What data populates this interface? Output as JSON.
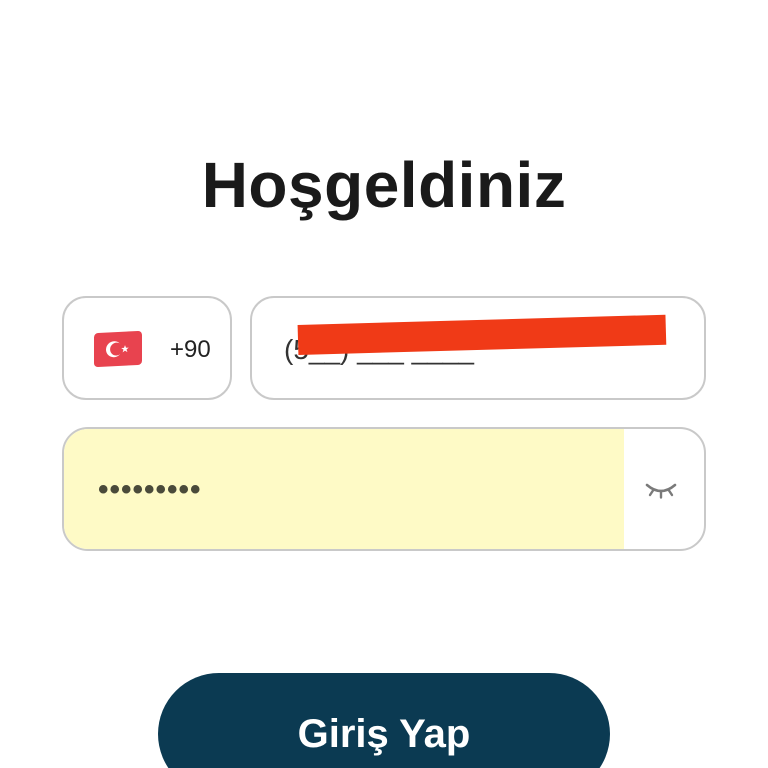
{
  "title": "Hoşgeldiniz",
  "phone": {
    "country_flag": "turkey-flag-icon",
    "dial_code": "+90",
    "value": "(5__) ___ ____"
  },
  "password": {
    "value": "•••••••••",
    "visibility_icon": "eye-closed-icon"
  },
  "login_button": "Giriş Yap",
  "colors": {
    "button_bg": "#0b3a52",
    "autofill_bg": "#fefac6",
    "border": "#c9c9c9",
    "redaction": "#f03a17"
  }
}
